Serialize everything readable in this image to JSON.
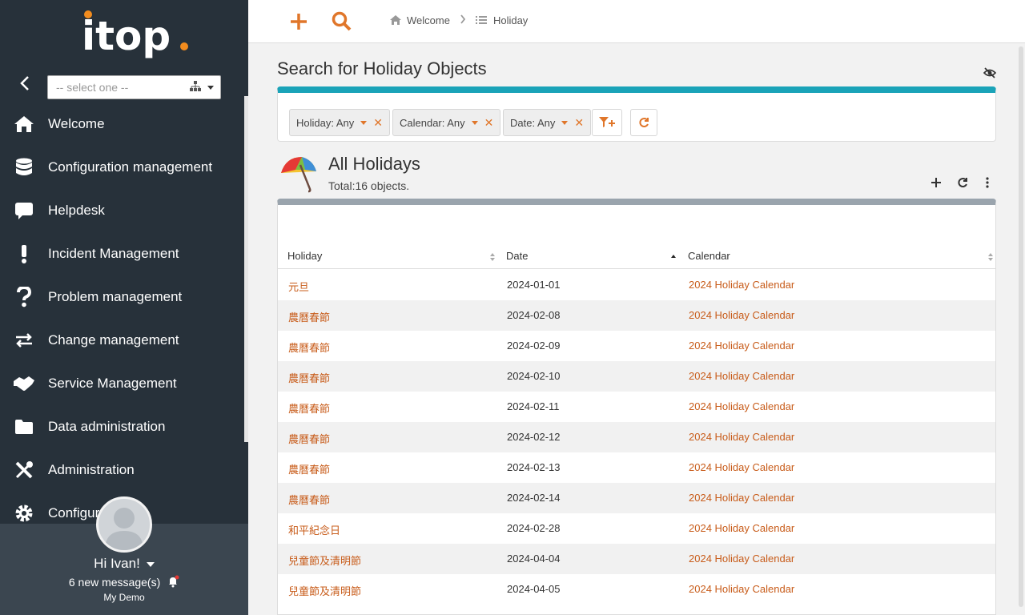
{
  "brand": {
    "logo_text": "itop",
    "accent": "#f28c1e"
  },
  "sidebar": {
    "org_select": {
      "placeholder": "-- select one --"
    },
    "items": [
      {
        "label": "Welcome",
        "icon": "home-icon"
      },
      {
        "label": "Configuration management",
        "icon": "database-icon"
      },
      {
        "label": "Helpdesk",
        "icon": "comment-icon"
      },
      {
        "label": "Incident Management",
        "icon": "exclamation-icon"
      },
      {
        "label": "Problem management",
        "icon": "question-icon"
      },
      {
        "label": "Change management",
        "icon": "exchange-icon"
      },
      {
        "label": "Service Management",
        "icon": "handshake-icon"
      },
      {
        "label": "Data administration",
        "icon": "folder-icon"
      },
      {
        "label": "Administration",
        "icon": "tools-icon"
      },
      {
        "label": "Configur",
        "icon": "gear-icon"
      }
    ],
    "user": {
      "greeting": "Hi Ivan!",
      "messages": "6 new message(s)",
      "organization": "My Demo"
    }
  },
  "topbar": {
    "breadcrumbs": [
      {
        "label": "Welcome",
        "icon": "home-icon"
      },
      {
        "label": "Holiday",
        "icon": "list-icon"
      }
    ]
  },
  "search": {
    "title": "Search for Holiday Objects",
    "criteria": [
      {
        "label": "Holiday: Any"
      },
      {
        "label": "Calendar: Any"
      },
      {
        "label": "Date: Any"
      }
    ],
    "accent": "#1aa3b8"
  },
  "list": {
    "title": "All Holidays",
    "count": "Total:16 objects.",
    "columns": [
      "Holiday",
      "Date",
      "Calendar"
    ],
    "rows": [
      {
        "holiday": "元旦",
        "date": "2024-01-01",
        "calendar": "2024 Holiday Calendar"
      },
      {
        "holiday": "農曆春節",
        "date": "2024-02-08",
        "calendar": "2024 Holiday Calendar"
      },
      {
        "holiday": "農曆春節",
        "date": "2024-02-09",
        "calendar": "2024 Holiday Calendar"
      },
      {
        "holiday": "農曆春節",
        "date": "2024-02-10",
        "calendar": "2024 Holiday Calendar"
      },
      {
        "holiday": "農曆春節",
        "date": "2024-02-11",
        "calendar": "2024 Holiday Calendar"
      },
      {
        "holiday": "農曆春節",
        "date": "2024-02-12",
        "calendar": "2024 Holiday Calendar"
      },
      {
        "holiday": "農曆春節",
        "date": "2024-02-13",
        "calendar": "2024 Holiday Calendar"
      },
      {
        "holiday": "農曆春節",
        "date": "2024-02-14",
        "calendar": "2024 Holiday Calendar"
      },
      {
        "holiday": "和平紀念日",
        "date": "2024-02-28",
        "calendar": "2024 Holiday Calendar"
      },
      {
        "holiday": "兒童節及清明節",
        "date": "2024-04-04",
        "calendar": "2024 Holiday Calendar"
      },
      {
        "holiday": "兒童節及清明節",
        "date": "2024-04-05",
        "calendar": "2024 Holiday Calendar"
      }
    ]
  }
}
